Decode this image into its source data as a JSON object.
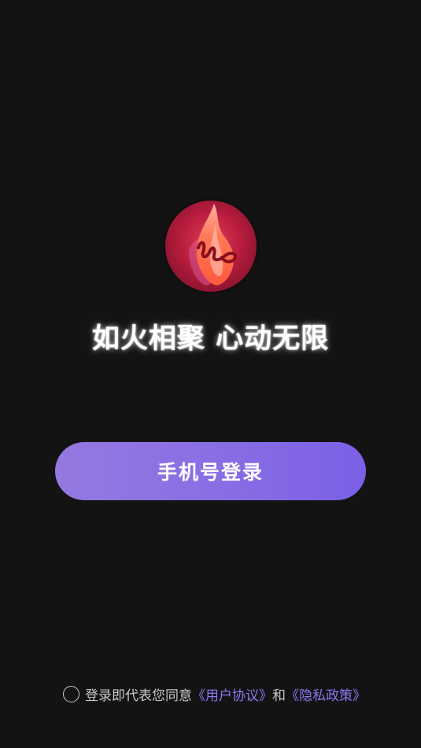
{
  "logo": {
    "icon": "flame-logo-icon"
  },
  "slogan": "如火相聚 心动无限",
  "login_button": {
    "label": "手机号登录"
  },
  "agreement": {
    "prefix": "登录即代表您同意",
    "user_agreement": "《用户协议》",
    "conjunction": "和",
    "privacy_policy": "《隐私政策》"
  },
  "colors": {
    "background": "#131314",
    "accent": "#8a6ee4",
    "link": "#8d78f2",
    "logo_red": "#c41f42"
  }
}
